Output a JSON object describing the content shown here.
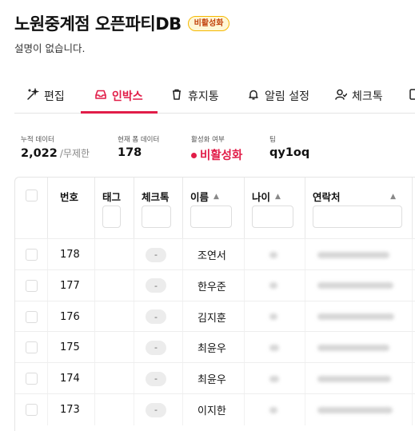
{
  "page": {
    "title": "노원중계점 오픈파티DB",
    "status_badge": "비활성화",
    "description": "설명이 없습니다."
  },
  "tabs": [
    {
      "label": "편집",
      "icon": "magic-wand-icon",
      "active": false
    },
    {
      "label": "인박스",
      "icon": "inbox-icon",
      "active": true
    },
    {
      "label": "휴지통",
      "icon": "trash-icon",
      "active": false
    },
    {
      "label": "알림 설정",
      "icon": "bell-icon",
      "active": false
    },
    {
      "label": "체크톡",
      "icon": "user-icon",
      "active": false
    }
  ],
  "stats": {
    "cumulative_label": "누적 데이터",
    "cumulative_value": "2,022",
    "cumulative_unit": "/무제한",
    "current_label": "현재 폼 데이터",
    "current_value": "178",
    "status_label": "활성화 여부",
    "status_value": "비활성화",
    "team_label": "팀",
    "team_value": "qy1oq"
  },
  "table": {
    "headers": {
      "number": "번호",
      "tag": "태그",
      "checktalk": "체크톡",
      "name": "이름",
      "age": "나이",
      "contact": "연락처"
    },
    "rows": [
      {
        "number": "178",
        "checktalk": "-",
        "name": "조연서"
      },
      {
        "number": "177",
        "checktalk": "-",
        "name": "한우준"
      },
      {
        "number": "176",
        "checktalk": "-",
        "name": "김지훈"
      },
      {
        "number": "175",
        "checktalk": "-",
        "name": "최윤우"
      },
      {
        "number": "174",
        "checktalk": "-",
        "name": "최윤우"
      },
      {
        "number": "173",
        "checktalk": "-",
        "name": "이지한"
      }
    ]
  },
  "colors": {
    "accent": "#e11d48",
    "badge_border": "#f5b800",
    "badge_bg": "#fff7d6"
  }
}
